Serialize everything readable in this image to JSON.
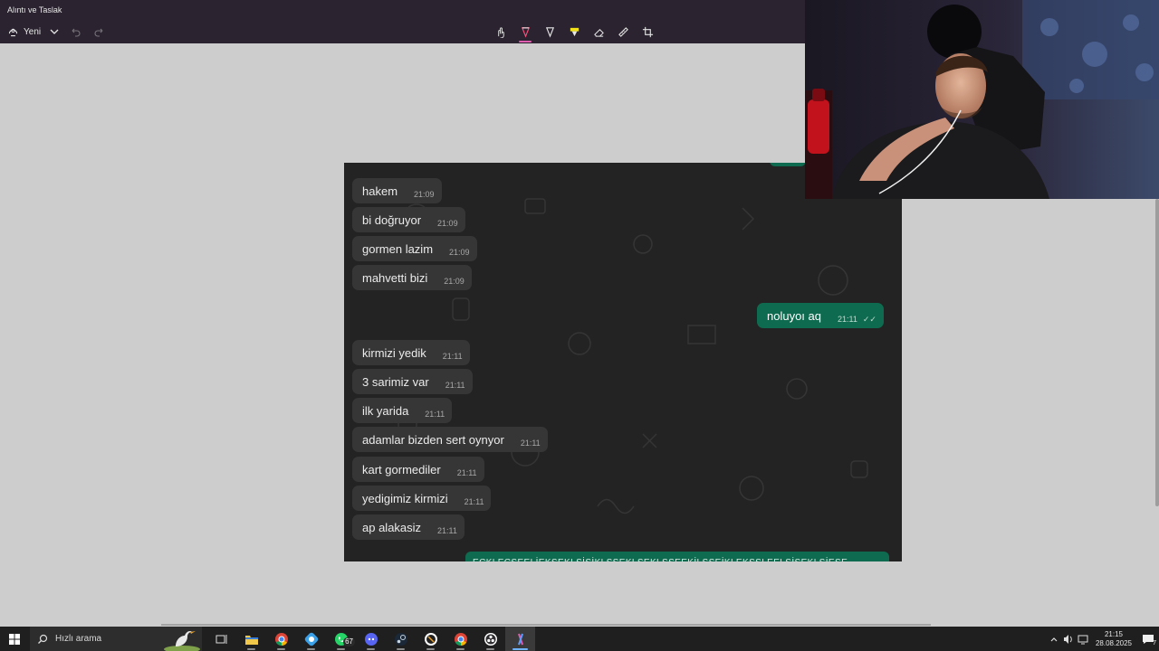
{
  "titlebar": {
    "title": "Alıntı ve Taslak"
  },
  "toolbar": {
    "new_label": "Yeni"
  },
  "chat": {
    "incoming_top": [
      {
        "text": "hakem",
        "time": "21:09"
      },
      {
        "text": "bi doğruyor",
        "time": "21:09"
      },
      {
        "text": "gormen lazim",
        "time": "21:09"
      },
      {
        "text": "mahvetti bizi",
        "time": "21:09"
      }
    ],
    "outgoing": {
      "text": "noluyoı aq",
      "time": "21:11",
      "ticks": "✓✓"
    },
    "incoming_bottom": [
      {
        "text": "kirmizi yedik",
        "time": "21:11"
      },
      {
        "text": "3 sarimiz var",
        "time": "21:11"
      },
      {
        "text": "ilk yarida",
        "time": "21:11"
      },
      {
        "text": "adamlar bizden sert oynyor",
        "time": "21:11"
      },
      {
        "text": "kart gormediler",
        "time": "21:11"
      },
      {
        "text": "yedigimiz kirmizi",
        "time": "21:11"
      },
      {
        "text": "ap alakasiz",
        "time": "21:11"
      }
    ],
    "cut_message": "ECKLECSEELİEKSEKLSİSİKLSSEKLSEKLSSEEKİLSSEİKLEKSSLEELSİSEKLSİESE"
  },
  "taskbar": {
    "search_placeholder": "Hızlı arama",
    "whatsapp_badge": "67",
    "clock_time": "21:15",
    "clock_date": "28.08.2025",
    "notification_count": "7",
    "apps": [
      "task-view",
      "file-explorer",
      "chrome",
      "app-blue",
      "whatsapp",
      "discord",
      "steam",
      "counter-strike",
      "chrome-2",
      "obs",
      "snipping-tool"
    ]
  },
  "colors": {
    "accent": "#e05fb0",
    "outgoing_bubble": "#0f6b4f",
    "incoming_bubble": "#363636"
  }
}
